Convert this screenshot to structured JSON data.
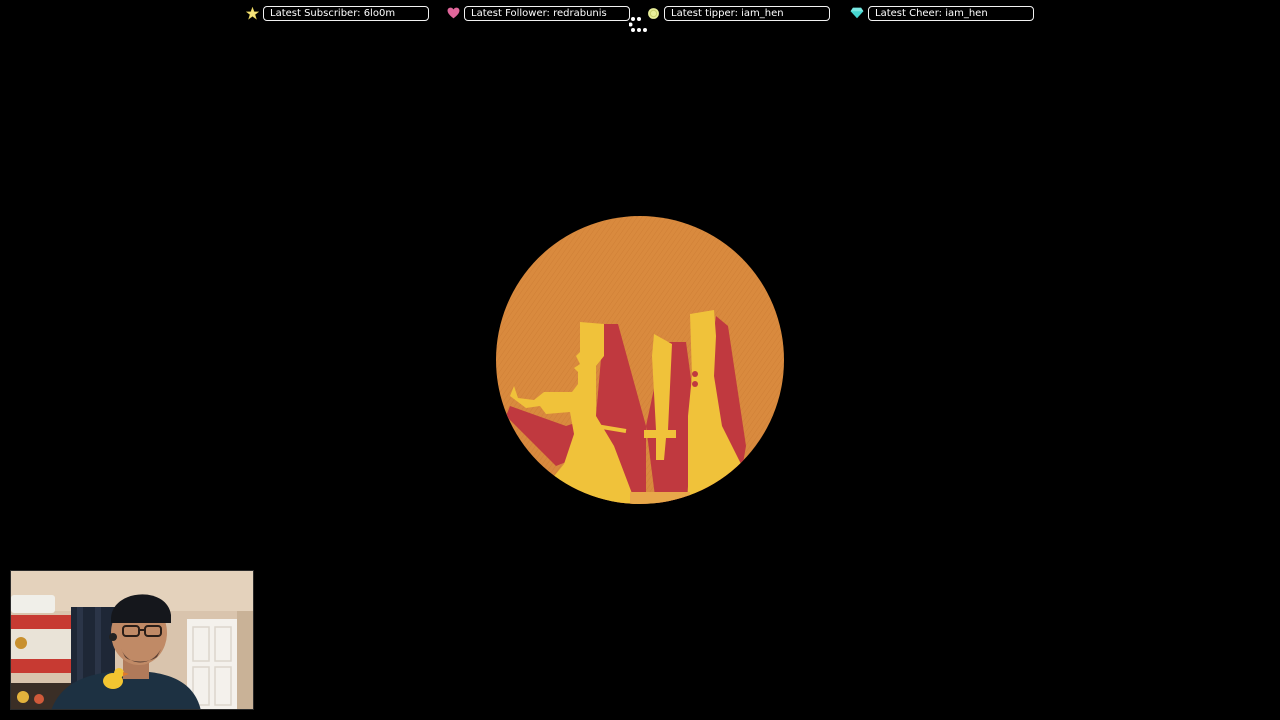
{
  "alerts": {
    "subscriber": {
      "label": "Latest Subscriber: 6lo0m",
      "icon": "star-icon",
      "color": "#f5e37a"
    },
    "follower": {
      "label": "Latest Follower:  redrabunis",
      "icon": "heart-icon",
      "color": "#e0669a"
    },
    "tipper": {
      "label": "Latest tipper: iam_hen",
      "icon": "coin-icon",
      "color": "#e8ef9a"
    },
    "cheer": {
      "label": "Latest Cheer: iam_hen",
      "icon": "diamond-icon",
      "color": "#46d6d0"
    }
  },
  "logo": {
    "icon": "crossed-weapons-emblem",
    "background_color": "#d98a3e",
    "shadow_color": "#c0393f",
    "silhouette_color": "#f0c23a"
  },
  "webcam": {
    "description_icon": "webcam-feed"
  }
}
